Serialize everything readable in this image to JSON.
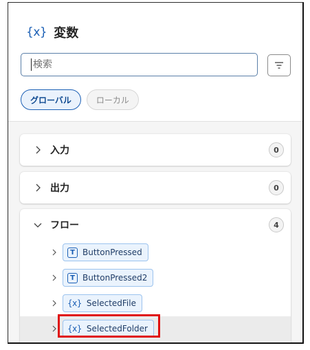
{
  "panel": {
    "title_icon": "{x}",
    "title": "変数"
  },
  "search": {
    "placeholder": "検索",
    "value": ""
  },
  "filter_button": {
    "icon": "filter-lines-icon"
  },
  "scope_tabs": [
    {
      "label": "グローバル",
      "selected": true
    },
    {
      "label": "ローカル",
      "selected": false
    }
  ],
  "sections": [
    {
      "label": "入力",
      "count": "0",
      "expanded": false
    },
    {
      "label": "出力",
      "count": "0",
      "expanded": false
    },
    {
      "label": "フロー",
      "count": "4",
      "expanded": true,
      "variables": [
        {
          "name": "ButtonPressed",
          "type_icon": "T"
        },
        {
          "name": "ButtonPressed2",
          "type_icon": "T"
        },
        {
          "name": "SelectedFile",
          "type_icon": "{x}"
        },
        {
          "name": "SelectedFolder",
          "type_icon": "{x}",
          "highlighted": true
        }
      ]
    }
  ],
  "colors": {
    "accent": "#1b5fb5",
    "annotation": "#e01010"
  }
}
